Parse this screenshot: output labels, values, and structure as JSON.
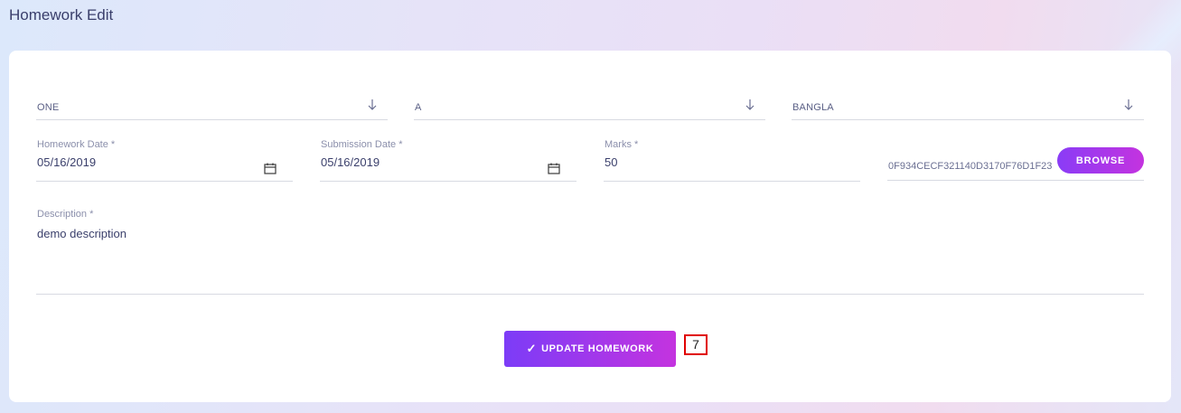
{
  "page": {
    "title": "Homework Edit"
  },
  "form": {
    "class_select": {
      "value": "ONE",
      "icon": "arrow-down-icon"
    },
    "section_select": {
      "value": "A",
      "icon": "arrow-down-icon"
    },
    "subject_select": {
      "value": "BANGLA",
      "icon": "arrow-down-icon"
    },
    "homework_date": {
      "label": "Homework Date *",
      "value": "05/16/2019",
      "icon": "calendar-icon"
    },
    "submission_date": {
      "label": "Submission Date *",
      "value": "05/16/2019",
      "icon": "calendar-icon"
    },
    "marks": {
      "label": "Marks *",
      "value": "50"
    },
    "file": {
      "value": "0F934CECF321140D3170F76D1F23",
      "browse_label": "BROWSE"
    },
    "description": {
      "label": "Description *",
      "value": "demo description"
    },
    "submit": {
      "label": "UPDATE HOMEWORK",
      "icon": "check-icon",
      "check_glyph": "✓"
    }
  },
  "annotation": {
    "badge": "7",
    "color": "#e00000"
  },
  "colors": {
    "accent_start": "#7c3cf7",
    "accent_end": "#c433df",
    "text": "#3a3f6b",
    "label": "#8b8fab"
  }
}
